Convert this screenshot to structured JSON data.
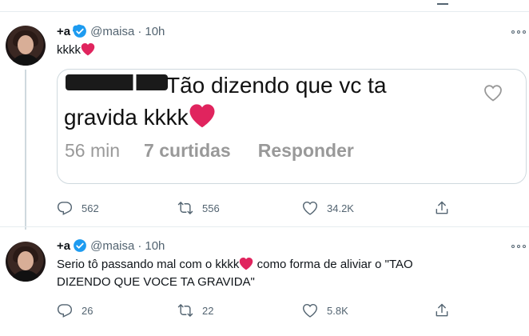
{
  "tweet1": {
    "name": "+a",
    "handle": "@maisa",
    "time": "10h",
    "text": "kkkk",
    "embed": {
      "text_line1": "Tão dizendo que vc ta",
      "text_line2": "gravida kkkk",
      "age": "56 min",
      "likes": "7 curtidas",
      "reply": "Responder"
    },
    "stats": {
      "replies": "562",
      "retweets": "556",
      "likes": "34.2K"
    }
  },
  "tweet2": {
    "name": "+a",
    "handle": "@maisa",
    "time": "10h",
    "text_part1": "Serio tô passando mal com o kkkk",
    "text_part2": " como forma de aliviar o \"TAO",
    "text_line2": "DIZENDO QUE VOCE TA GRAVIDA\"",
    "stats": {
      "replies": "26",
      "retweets": "22",
      "likes": "5.8K"
    }
  },
  "colors": {
    "verified": "#1d9bf0",
    "heart": "#e0245e",
    "muted": "#536471",
    "embed_meta": "#999999"
  },
  "icons": [
    "verified-badge-icon",
    "more-icon",
    "reply-icon",
    "retweet-icon",
    "like-icon",
    "share-icon",
    "red-heart-emoji"
  ]
}
